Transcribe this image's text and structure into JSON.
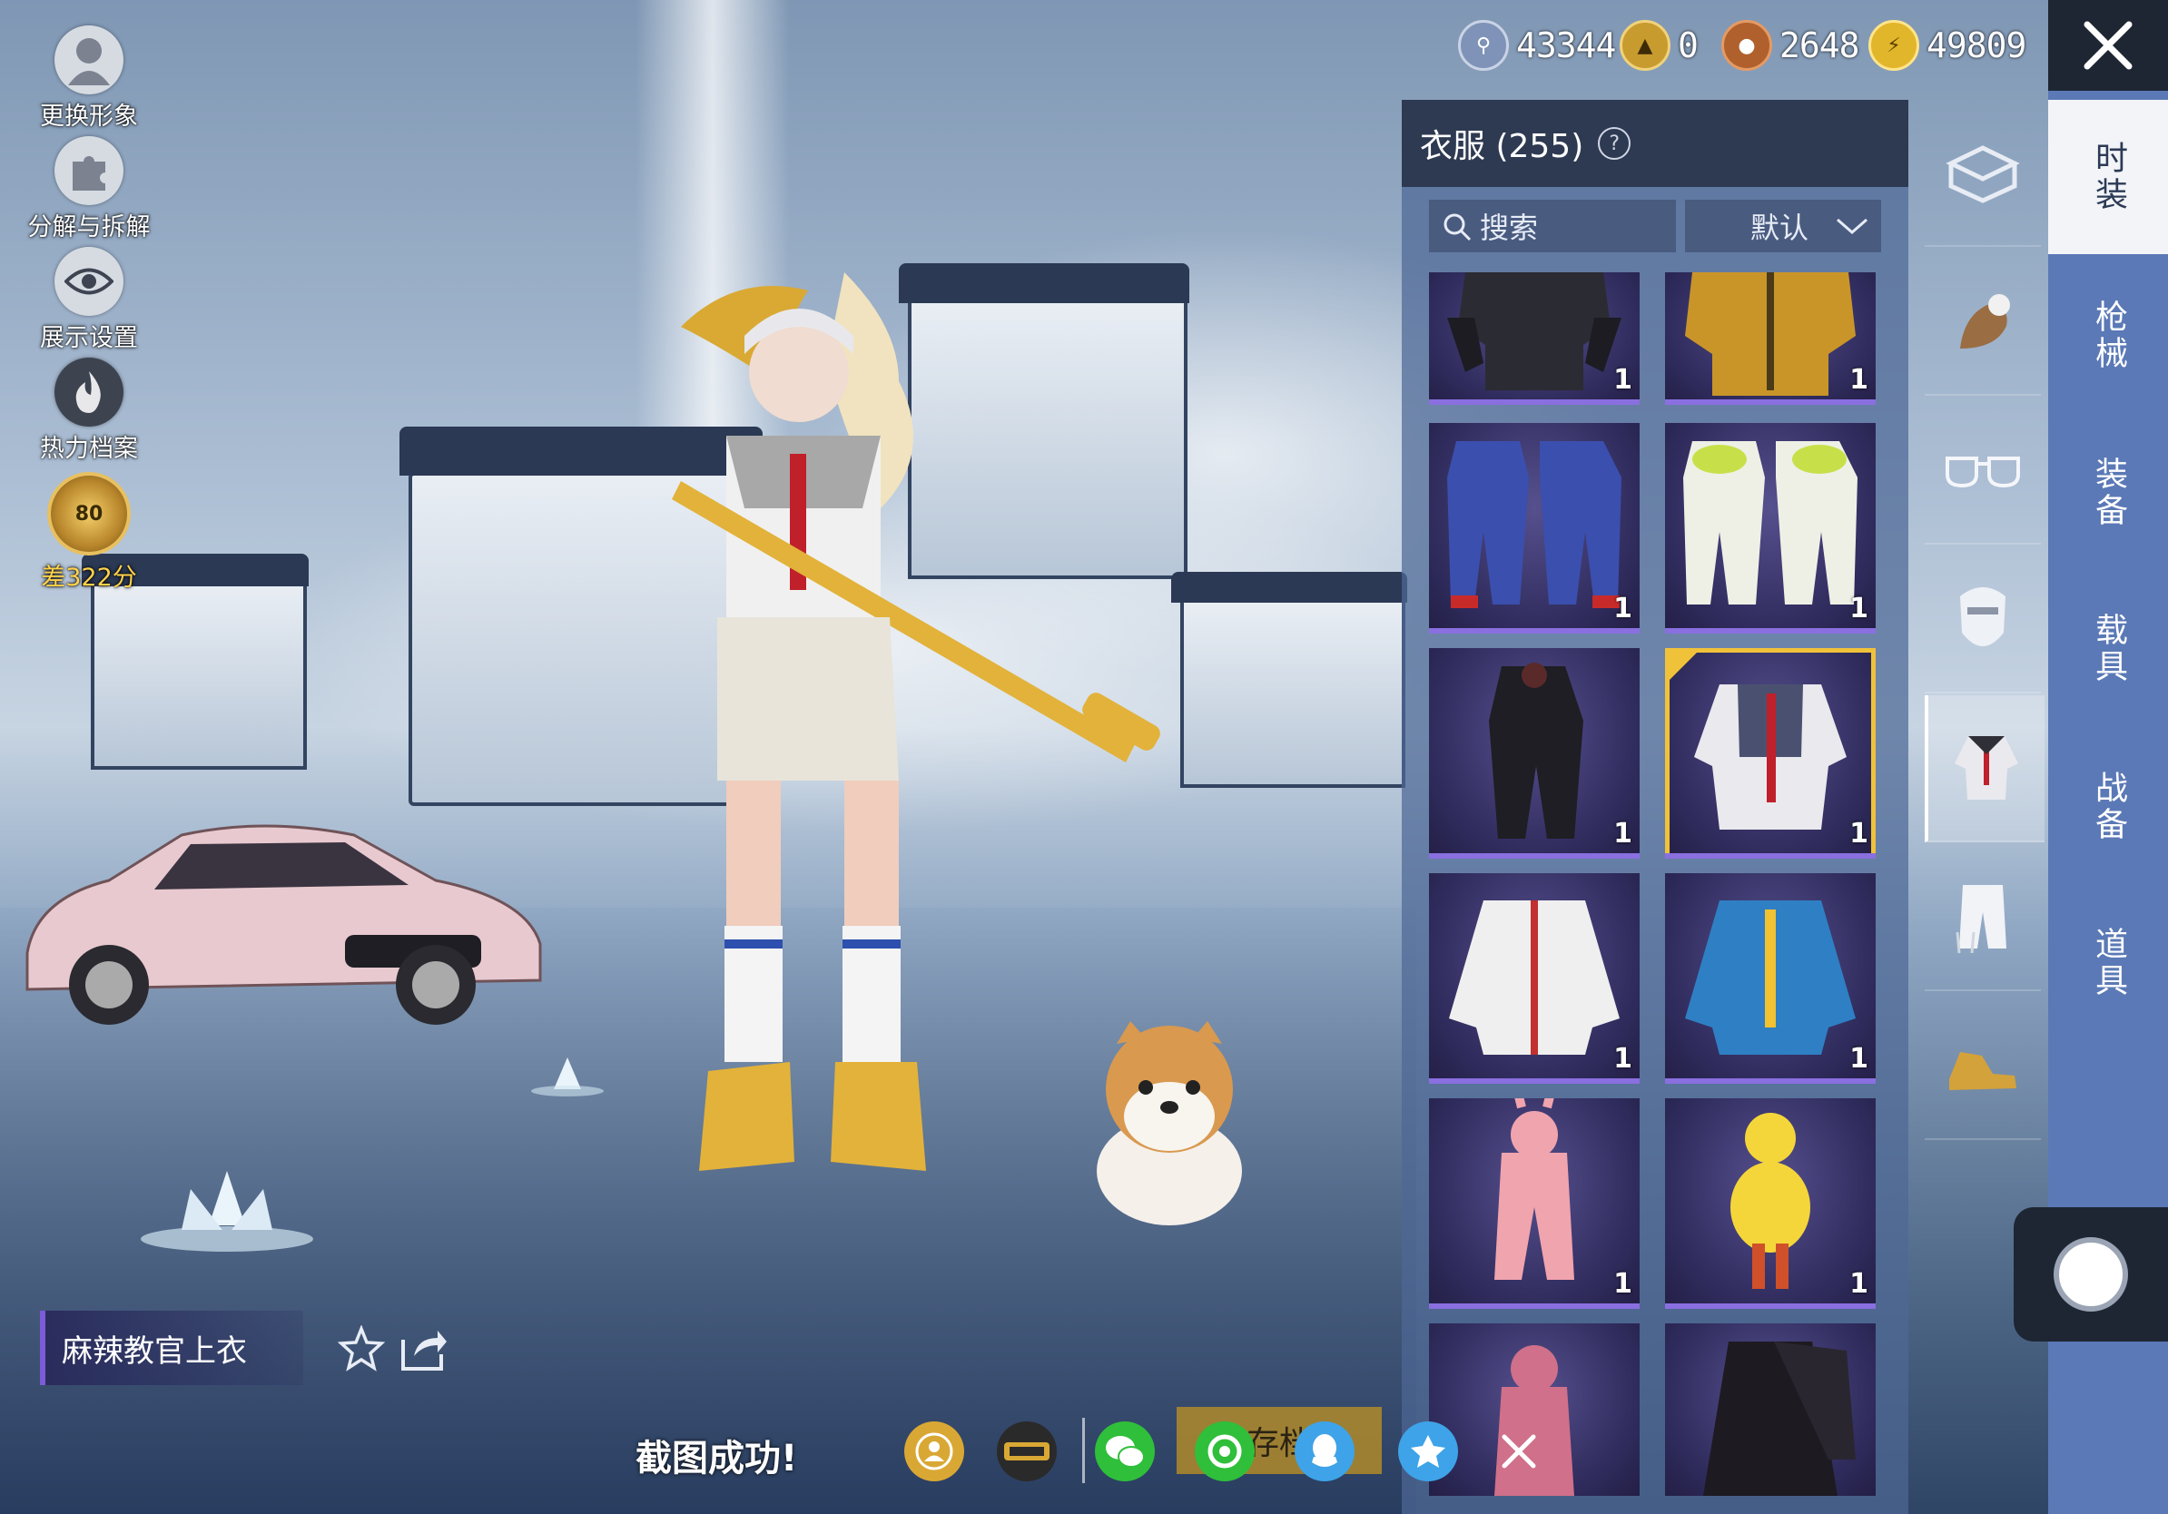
{
  "left_menu": {
    "items": [
      {
        "label": "更换形象",
        "icon": "avatar-icon"
      },
      {
        "label": "分解与拆解",
        "icon": "puzzle-icon"
      },
      {
        "label": "展示设置",
        "icon": "eye-icon"
      },
      {
        "label": "热力档案",
        "icon": "fire-icon"
      }
    ],
    "rank": {
      "level": "80",
      "label": "差322分"
    }
  },
  "currencies": [
    {
      "icon": "silver-coin-icon",
      "value": "43344",
      "color": "#7f93b8"
    },
    {
      "icon": "gold-token-icon",
      "value": "0",
      "color": "#c89b2e"
    },
    {
      "icon": "bronze-coin-icon",
      "value": "2648",
      "color": "#b0602c"
    },
    {
      "icon": "energy-coin-icon",
      "value": "49809",
      "color": "#e2b62a"
    }
  ],
  "right_tabs": [
    {
      "label": "时装",
      "active": true
    },
    {
      "label": "枪械",
      "active": false
    },
    {
      "label": "装备",
      "active": false
    },
    {
      "label": "载具",
      "active": false
    },
    {
      "label": "战备",
      "active": false
    },
    {
      "label": "道具",
      "active": false
    }
  ],
  "categories": [
    {
      "icon": "box-icon",
      "active": false
    },
    {
      "icon": "backpack-pet-icon",
      "active": false
    },
    {
      "icon": "glasses-icon",
      "active": false
    },
    {
      "icon": "mask-icon",
      "active": false
    },
    {
      "icon": "outfit-icon",
      "active": true
    },
    {
      "icon": "pants-icon",
      "active": false
    },
    {
      "icon": "shoes-icon",
      "active": false
    }
  ],
  "panel": {
    "title": "衣服 (255)",
    "help": "?",
    "search_label": "搜索",
    "sort_label": "默认",
    "items": [
      {
        "name": "black-leather-jacket",
        "qty": "1",
        "selected": false
      },
      {
        "name": "yellow-puffer-jacket",
        "qty": "1",
        "selected": false
      },
      {
        "name": "blue-red-tracksuit",
        "qty": "1",
        "selected": false
      },
      {
        "name": "green-white-suit",
        "qty": "1",
        "selected": false
      },
      {
        "name": "black-tactical-suit",
        "qty": "1",
        "selected": false
      },
      {
        "name": "instructor-top",
        "qty": "1",
        "selected": true
      },
      {
        "name": "white-jacket",
        "qty": "1",
        "selected": false
      },
      {
        "name": "blue-pilot-jacket",
        "qty": "1",
        "selected": false
      },
      {
        "name": "pink-bunny-suit",
        "qty": "1",
        "selected": false
      },
      {
        "name": "chick-costume",
        "qty": "1",
        "selected": false
      },
      {
        "name": "pink-bunny-hood",
        "qty": "",
        "selected": false
      },
      {
        "name": "black-dress",
        "qty": "",
        "selected": false
      }
    ]
  },
  "item_detail": {
    "name": "麻辣教官上衣"
  },
  "share_bar": {
    "toast": "截图成功!",
    "save_label": "存档",
    "icons": [
      "peace-elite-circle-icon",
      "peace-elite-logo-icon",
      "wechat-icon",
      "moments-icon",
      "qq-icon",
      "qzone-icon",
      "close-icon"
    ]
  }
}
